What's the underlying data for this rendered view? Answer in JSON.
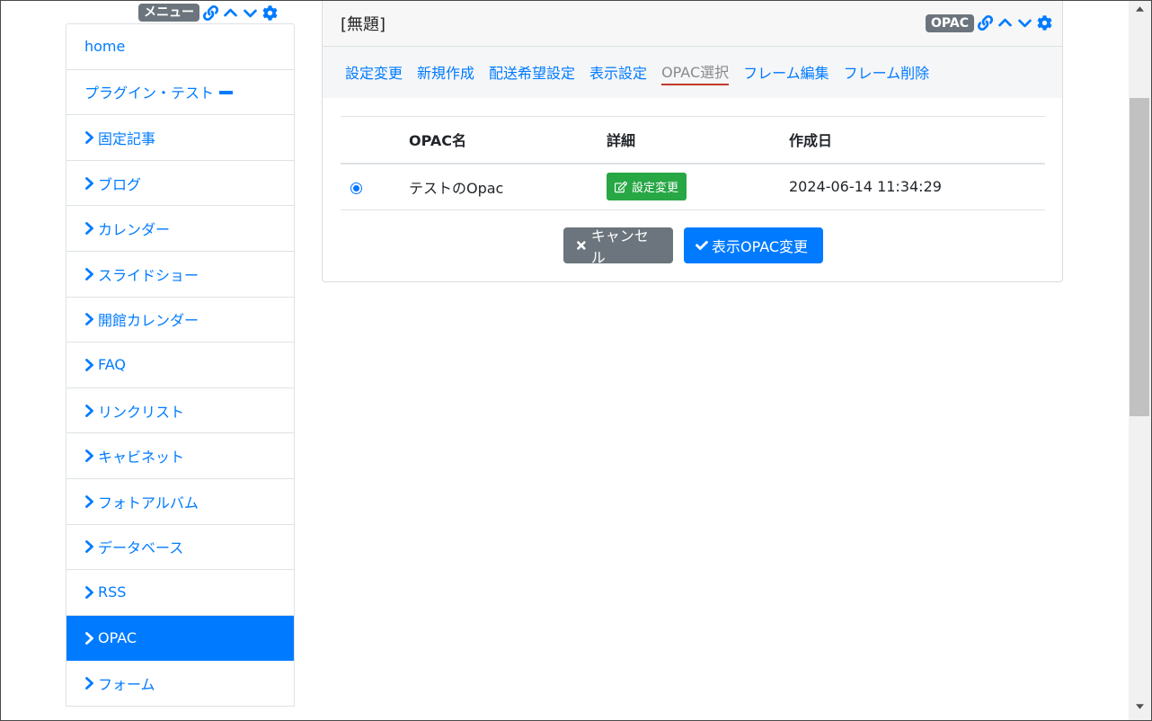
{
  "menu_frame": {
    "badge": "メニュー",
    "items": [
      {
        "label": "home",
        "type": "plain"
      },
      {
        "label": "プラグイン・テスト",
        "type": "dash"
      },
      {
        "label": "固定記事",
        "type": "chevron"
      },
      {
        "label": "ブログ",
        "type": "chevron"
      },
      {
        "label": "カレンダー",
        "type": "chevron"
      },
      {
        "label": "スライドショー",
        "type": "chevron"
      },
      {
        "label": "開館カレンダー",
        "type": "chevron"
      },
      {
        "label": "FAQ",
        "type": "chevron"
      },
      {
        "label": "リンクリスト",
        "type": "chevron"
      },
      {
        "label": "キャビネット",
        "type": "chevron"
      },
      {
        "label": "フォトアルバム",
        "type": "chevron"
      },
      {
        "label": "データベース",
        "type": "chevron"
      },
      {
        "label": "RSS",
        "type": "chevron"
      },
      {
        "label": "OPAC",
        "type": "chevron",
        "active": true
      },
      {
        "label": "フォーム",
        "type": "chevron"
      }
    ]
  },
  "main_frame": {
    "title": "[無題]",
    "badge": "OPAC",
    "tabs": [
      {
        "label": "設定変更"
      },
      {
        "label": "新規作成"
      },
      {
        "label": "配送希望設定"
      },
      {
        "label": "表示設定"
      },
      {
        "label": "OPAC選択",
        "active": true
      },
      {
        "label": "フレーム編集"
      },
      {
        "label": "フレーム削除"
      }
    ],
    "table": {
      "headers": [
        "",
        "OPAC名",
        "詳細",
        "作成日"
      ],
      "rows": [
        {
          "selected": true,
          "name": "テストのOpac",
          "detail_button": "設定変更",
          "created": "2024-06-14 11:34:29"
        }
      ]
    },
    "cancel_label": "キャンセル",
    "submit_label": "表示OPAC変更"
  },
  "colors": {
    "link": "#007bff",
    "badge": "#6c757d",
    "active_bg": "#007bff",
    "edit_button": "#28a745",
    "tab_underline": "#c0392b"
  },
  "icons": [
    "link-icon",
    "chevron-up-icon",
    "chevron-down-icon",
    "gear-icon",
    "chevron-right-icon",
    "edit-icon",
    "times-icon",
    "check-icon"
  ]
}
